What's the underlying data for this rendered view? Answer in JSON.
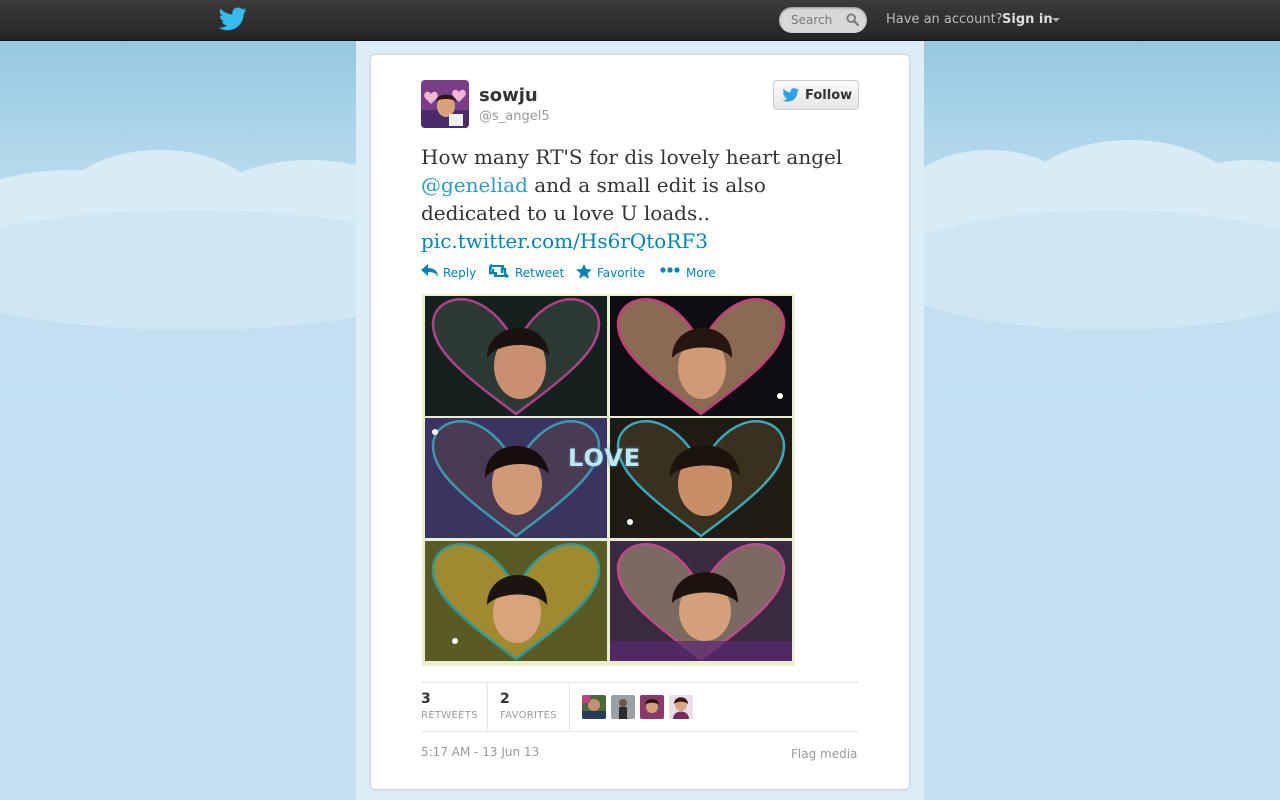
{
  "topbar": {
    "logo_icon": "twitter-bird-icon",
    "search": {
      "placeholder": "Search",
      "icon": "magnifier-icon"
    },
    "account_prompt": "Have an account?",
    "sign_in_label": "Sign in"
  },
  "tweet": {
    "author": {
      "name": "sowju",
      "handle": "@s_angel5"
    },
    "follow_label": "Follow",
    "text_before_mention": "How many RT'S for dis lovely heart angel ",
    "mention": "@geneliad",
    "text_after_mention": " and a small edit is also dedicated to u love U loads..",
    "link": "pic.twitter.com/Hs6rQtoRF3",
    "actions": {
      "reply": "Reply",
      "retweet": "Retweet",
      "favorite": "Favorite",
      "more": "More"
    },
    "media_overlay_text": "LOVE",
    "stats": {
      "retweets": {
        "count": "3",
        "label": "RETWEETS"
      },
      "favorites": {
        "count": "2",
        "label": "FAVORITES"
      }
    },
    "timestamp": "5:17 AM - 13 Jun 13",
    "flag_label": "Flag media"
  },
  "colors": {
    "link": "#0084b4",
    "mention": "#2b9ac6",
    "topbar": "#2e2e2e"
  }
}
